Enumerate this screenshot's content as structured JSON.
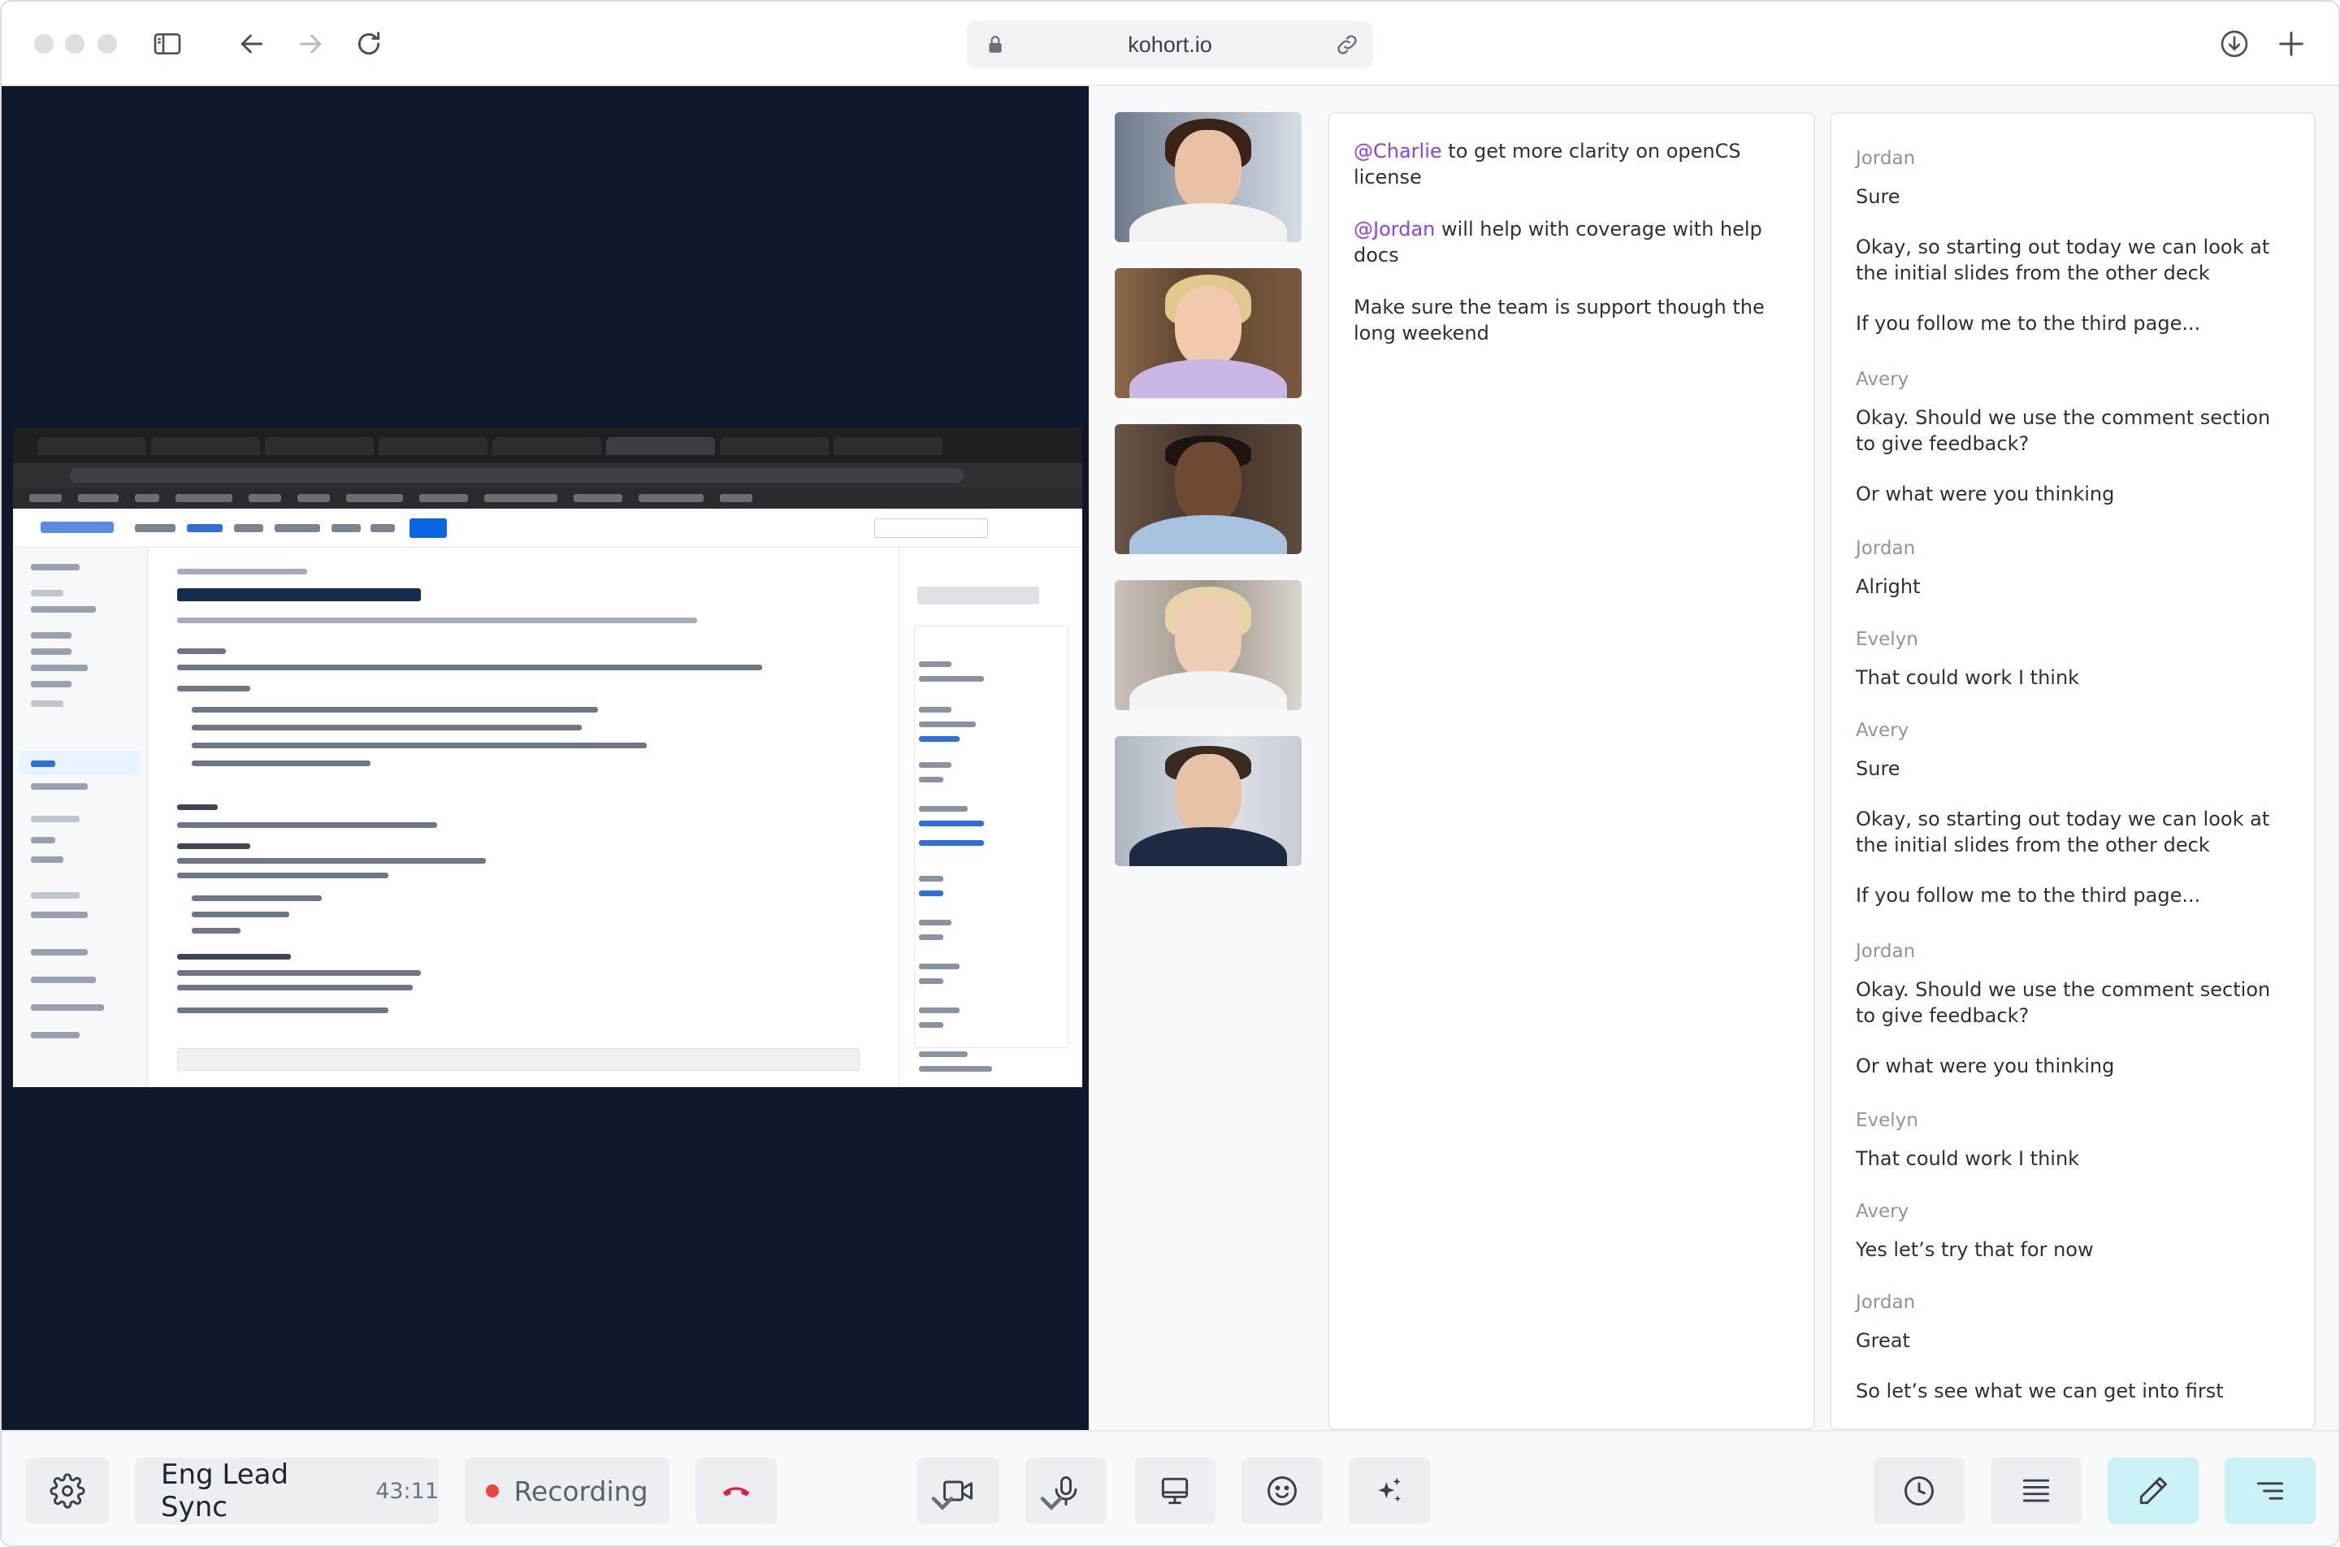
{
  "browser": {
    "url": "kohort.io"
  },
  "notes": [
    {
      "mention": "@Charlie",
      "text": " to get more clarity on openCS license"
    },
    {
      "mention": "@Jordan",
      "text": " will help with coverage with help docs"
    },
    {
      "mention": "",
      "text": "Make sure the team is support though the long weekend"
    }
  ],
  "transcript": [
    {
      "speaker": "Jordan",
      "lines": [
        "Sure",
        "Okay, so starting out today we can look at the initial slides from the other deck",
        "If you follow me to the third page..."
      ]
    },
    {
      "speaker": "Avery",
      "lines": [
        "Okay. Should we use the comment section to give feedback?",
        "Or what were you thinking"
      ]
    },
    {
      "speaker": "Jordan",
      "lines": [
        "Alright"
      ]
    },
    {
      "speaker": "Evelyn",
      "lines": [
        "That could work I think"
      ]
    },
    {
      "speaker": "Avery",
      "lines": [
        "Sure",
        "Okay, so starting out today we can look at the initial slides from the other deck",
        "If you follow me to the third page..."
      ]
    },
    {
      "speaker": "Jordan",
      "lines": [
        "Okay. Should we use the comment section to give feedback?",
        "Or what were you thinking"
      ]
    },
    {
      "speaker": "Evelyn",
      "lines": [
        "That could work I think"
      ]
    },
    {
      "speaker": "Avery",
      "lines": [
        "Yes let’s try that for now"
      ]
    },
    {
      "speaker": "Jordan",
      "lines": [
        "Great",
        "So let’s see what we can get into first"
      ]
    }
  ],
  "meeting": {
    "title": "Eng Lead Sync",
    "elapsed": "43:11",
    "recording_label": "Recording"
  },
  "participants": [
    {
      "tile": "participant-1",
      "skin": "#e9c1a4",
      "hair": "#3a2418",
      "shirt": "#f2f2f2",
      "bg": "#8f9bab"
    },
    {
      "tile": "participant-2",
      "skin": "#f1c9ad",
      "hair": "#e1c88f",
      "shirt": "#c9b6e4",
      "bg": "#7a5a3e"
    },
    {
      "tile": "participant-3",
      "skin": "#6f4a33",
      "hair": "#1d140f",
      "shirt": "#a8c3df",
      "bg": "#5e4b3b"
    },
    {
      "tile": "participant-4",
      "skin": "#efcdb4",
      "hair": "#e6d3a7",
      "shirt": "#f4f4f4",
      "bg": "#b9b3a9"
    },
    {
      "tile": "participant-5",
      "skin": "#e7c2a6",
      "hair": "#3a2a20",
      "shirt": "#1e2a44",
      "bg": "#c7ccd3"
    }
  ],
  "colors": {
    "accent": "#8a3ffc",
    "stage_bg": "#0f172a",
    "active_button": "#cbf3f7",
    "recording": "#ef4444",
    "hangup": "#e11d48"
  }
}
